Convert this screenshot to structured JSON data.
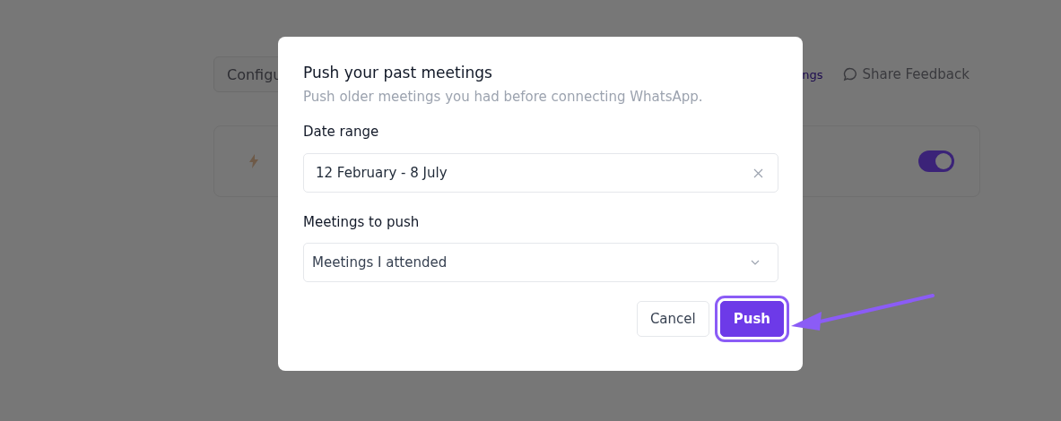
{
  "background": {
    "toolbar": {
      "configure_button": "Configu",
      "settings_link": "ngs",
      "feedback_link": "Share Feedback"
    },
    "card": {
      "toggle": {
        "on": true
      }
    }
  },
  "dialog": {
    "title": "Push your past meetings",
    "subtitle": "Push older meetings you had before connecting WhatsApp.",
    "fields": [
      {
        "kind": "date",
        "label": "Date range",
        "value": "12 February - 8 July"
      },
      {
        "kind": "select",
        "label": "Meetings to push",
        "value": "Meetings I attended"
      }
    ],
    "buttons": [
      {
        "kind": "secondary",
        "label": "Cancel",
        "highlighted": false
      },
      {
        "kind": "primary",
        "label": "Push",
        "highlighted": true
      }
    ]
  }
}
